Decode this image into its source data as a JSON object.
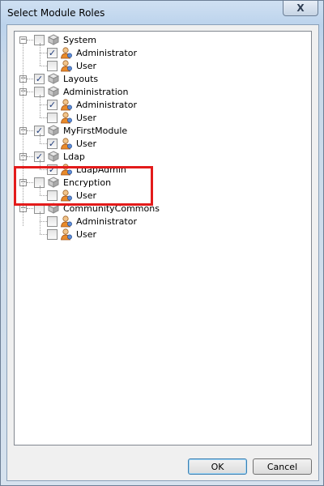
{
  "window": {
    "title": "Select Module Roles",
    "close_glyph": "X"
  },
  "tree": {
    "modules": [
      {
        "label": "System",
        "checked": false,
        "icon": "module-icon",
        "roles": [
          {
            "label": "Administrator",
            "checked": true
          },
          {
            "label": "User",
            "checked": false
          }
        ]
      },
      {
        "label": "Layouts",
        "checked": true,
        "icon": "module-icon",
        "roles": []
      },
      {
        "label": "Administration",
        "checked": false,
        "icon": "module-icon",
        "roles": [
          {
            "label": "Administrator",
            "checked": true
          },
          {
            "label": "User",
            "checked": false
          }
        ]
      },
      {
        "label": "MyFirstModule",
        "checked": true,
        "icon": "module-icon",
        "roles": [
          {
            "label": "User",
            "checked": true
          }
        ]
      },
      {
        "label": "Ldap",
        "checked": true,
        "icon": "module-icon",
        "roles": [
          {
            "label": "LdapAdmin",
            "checked": true
          }
        ]
      },
      {
        "label": "Encryption",
        "checked": false,
        "icon": "module-icon",
        "roles": [
          {
            "label": "User",
            "checked": false
          }
        ]
      },
      {
        "label": "CommunityCommons",
        "checked": false,
        "icon": "module-icon",
        "roles": [
          {
            "label": "Administrator",
            "checked": false
          },
          {
            "label": "User",
            "checked": false
          }
        ]
      }
    ]
  },
  "buttons": {
    "ok_label": "OK",
    "cancel_label": "Cancel"
  },
  "colors": {
    "highlight": "#e31b1b",
    "check": "#1f3b7a"
  }
}
